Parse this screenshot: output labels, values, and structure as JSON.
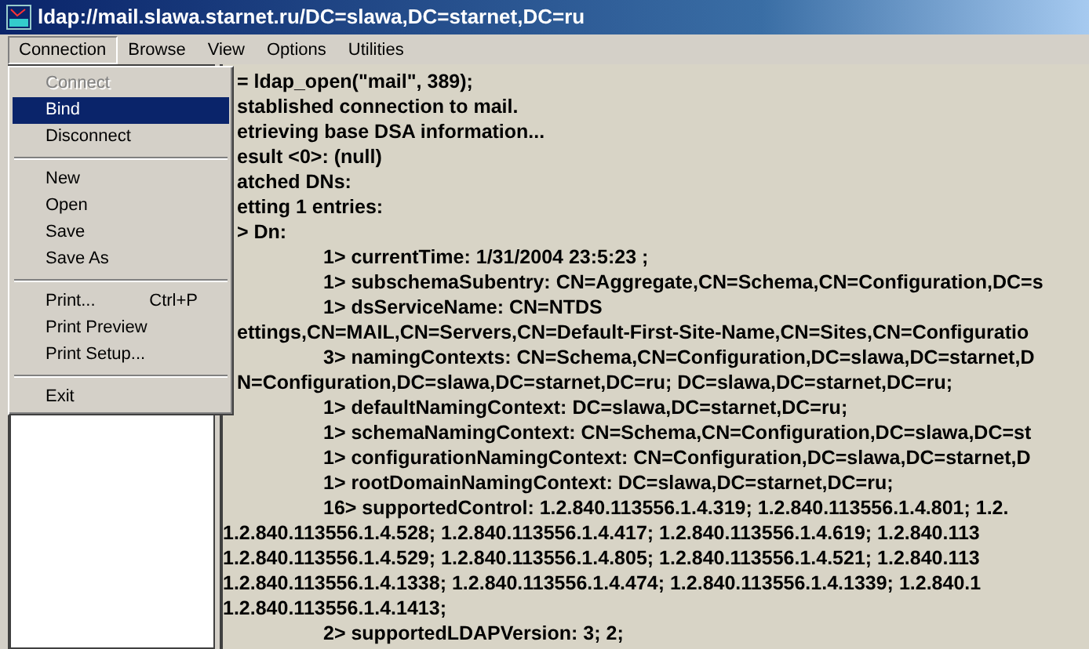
{
  "window": {
    "title": "ldap://mail.slawa.starnet.ru/DC=slawa,DC=starnet,DC=ru"
  },
  "menu_bar": [
    {
      "label": "Connection",
      "selected": true
    },
    {
      "label": "Browse",
      "selected": false
    },
    {
      "label": "View",
      "selected": false
    },
    {
      "label": "Options",
      "selected": false
    },
    {
      "label": "Utilities",
      "selected": false
    }
  ],
  "connection_menu": [
    {
      "kind": "item",
      "label": "Connect",
      "disabled": true,
      "selected": false
    },
    {
      "kind": "item",
      "label": "Bind",
      "disabled": false,
      "selected": true
    },
    {
      "kind": "item",
      "label": "Disconnect",
      "disabled": false,
      "selected": false
    },
    {
      "kind": "separator"
    },
    {
      "kind": "item",
      "label": "New",
      "disabled": false,
      "selected": false
    },
    {
      "kind": "item",
      "label": "Open",
      "disabled": false,
      "selected": false
    },
    {
      "kind": "item",
      "label": "Save",
      "disabled": false,
      "selected": false
    },
    {
      "kind": "item",
      "label": "Save As",
      "disabled": false,
      "selected": false
    },
    {
      "kind": "separator"
    },
    {
      "kind": "item",
      "label": "Print...",
      "shortcut": "Ctrl+P",
      "disabled": false,
      "selected": false
    },
    {
      "kind": "item",
      "label": "Print Preview",
      "disabled": false,
      "selected": false
    },
    {
      "kind": "item",
      "label": "Print Setup...",
      "disabled": false,
      "selected": false
    },
    {
      "kind": "separator"
    },
    {
      "kind": "item",
      "label": "Exit",
      "disabled": false,
      "selected": false
    }
  ],
  "log": [
    {
      "kind": "text",
      "text": "= ldap_open(\"mail\", 389);"
    },
    {
      "kind": "text",
      "text": "stablished connection to mail."
    },
    {
      "kind": "text",
      "text": "etrieving base DSA information..."
    },
    {
      "kind": "text",
      "text": "esult <0>: (null)"
    },
    {
      "kind": "text",
      "text": "atched DNs:"
    },
    {
      "kind": "text",
      "text": "etting 1 entries:"
    },
    {
      "kind": "text",
      "text": "> Dn:"
    },
    {
      "kind": "attr",
      "text": "1> currentTime: 1/31/2004 23:5:23  ;"
    },
    {
      "kind": "attr",
      "text": "1> subschemaSubentry: CN=Aggregate,CN=Schema,CN=Configuration,DC=s"
    },
    {
      "kind": "attr",
      "text": "1> dsServiceName: CN=NTDS"
    },
    {
      "kind": "text",
      "text": "ettings,CN=MAIL,CN=Servers,CN=Default-First-Site-Name,CN=Sites,CN=Configuratio"
    },
    {
      "kind": "attr",
      "text": "3> namingContexts: CN=Schema,CN=Configuration,DC=slawa,DC=starnet,D"
    },
    {
      "kind": "text",
      "text": "N=Configuration,DC=slawa,DC=starnet,DC=ru; DC=slawa,DC=starnet,DC=ru;"
    },
    {
      "kind": "attr",
      "text": "1> defaultNamingContext: DC=slawa,DC=starnet,DC=ru;"
    },
    {
      "kind": "attr",
      "text": "1> schemaNamingContext: CN=Schema,CN=Configuration,DC=slawa,DC=st"
    },
    {
      "kind": "attr",
      "text": "1> configurationNamingContext: CN=Configuration,DC=slawa,DC=starnet,D"
    },
    {
      "kind": "attr",
      "text": "1> rootDomainNamingContext: DC=slawa,DC=starnet,DC=ru;"
    },
    {
      "kind": "attr",
      "text": "16> supportedControl: 1.2.840.113556.1.4.319; 1.2.840.113556.1.4.801; 1.2."
    },
    {
      "kind": "wrap",
      "text": "1.2.840.113556.1.4.528; 1.2.840.113556.1.4.417; 1.2.840.113556.1.4.619; 1.2.840.113"
    },
    {
      "kind": "wrap",
      "text": "1.2.840.113556.1.4.529; 1.2.840.113556.1.4.805; 1.2.840.113556.1.4.521; 1.2.840.113"
    },
    {
      "kind": "wrap",
      "text": "1.2.840.113556.1.4.1338; 1.2.840.113556.1.4.474; 1.2.840.113556.1.4.1339; 1.2.840.1"
    },
    {
      "kind": "wrap",
      "text": "1.2.840.113556.1.4.1413;"
    },
    {
      "kind": "attr",
      "text": "2> supportedLDAPVersion: 3; 2;"
    }
  ]
}
